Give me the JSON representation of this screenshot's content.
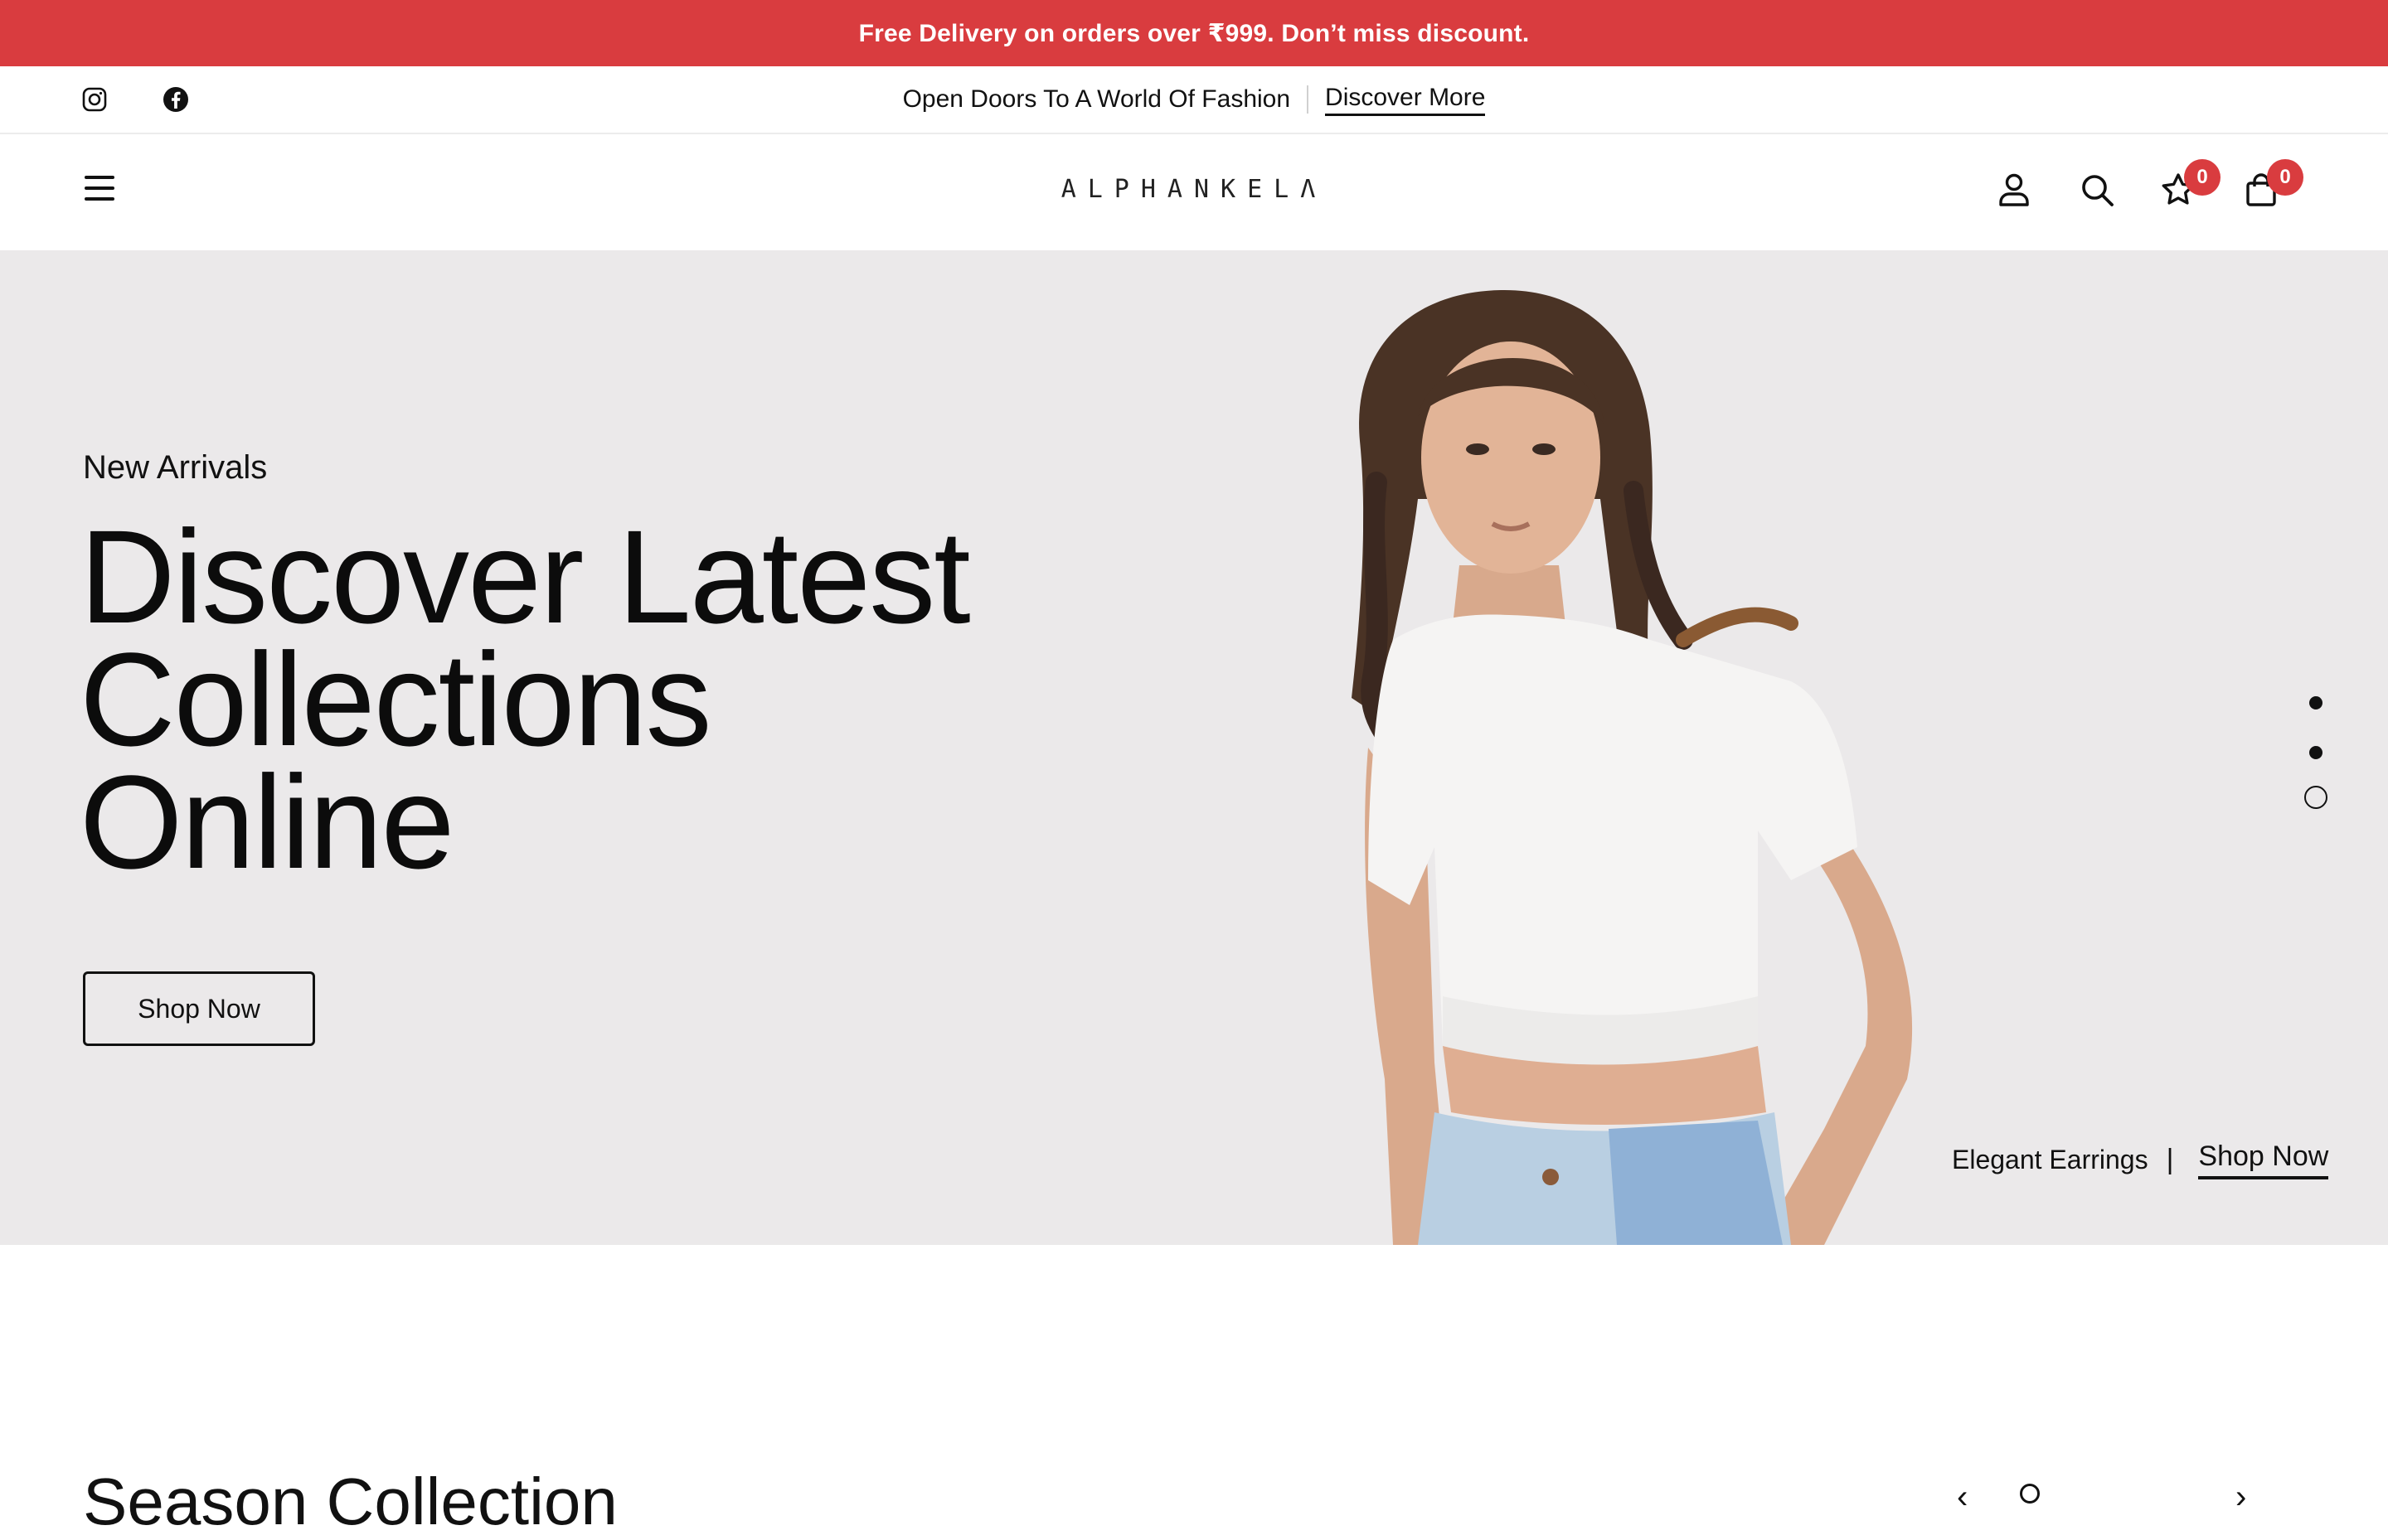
{
  "announcement": {
    "text": "Free Delivery on orders over ₹999. Don’t miss discount.",
    "background": "#d93c3f"
  },
  "subbar": {
    "social": [
      "instagram-icon",
      "facebook-icon"
    ],
    "promo_text": "Open Doors To A World Of Fashion",
    "promo_link": "Discover More"
  },
  "header": {
    "logo": "ALPHANKELΛ",
    "icons": [
      "menu-icon",
      "user-icon",
      "search-icon",
      "star-icon",
      "bag-icon"
    ],
    "wishlist_count": "0",
    "cart_count": "0"
  },
  "hero": {
    "subtitle": "New Arrivals",
    "title_line1": "Discover Latest",
    "title_line2": "Collections",
    "title_line3": "Online",
    "button": "Shop Now",
    "caption_product": "Elegant Earrings",
    "caption_separator": "|",
    "caption_cta": "Shop Now",
    "slides_total": 3,
    "active_slide": 3
  },
  "section": {
    "title_partial": "Season Collection"
  },
  "colors": {
    "accent": "#d93c3f",
    "hero_bg": "#ebe9ea",
    "text": "#111111"
  }
}
